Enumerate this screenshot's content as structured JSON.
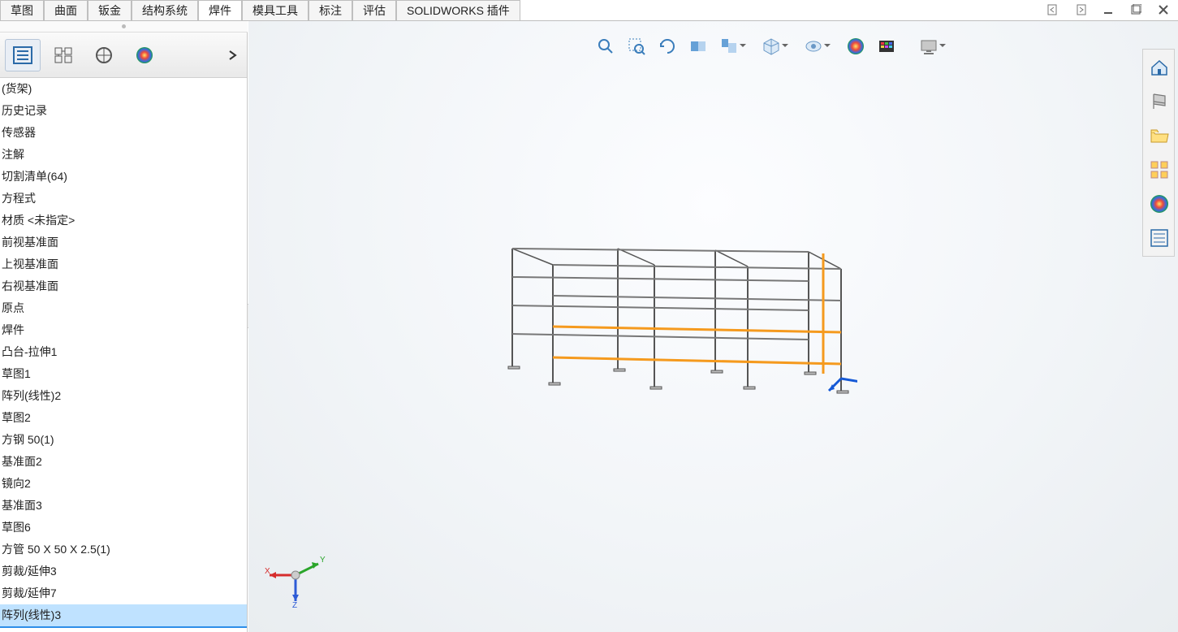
{
  "tabs": {
    "items": [
      "草图",
      "曲面",
      "钣金",
      "结构系统",
      "焊件",
      "模具工具",
      "标注",
      "评估",
      "SOLIDWORKS 插件"
    ],
    "activeIndex": 4
  },
  "windowControls": {
    "collapseLeft": "‹",
    "collapseRight": "›",
    "minimize": "—",
    "maximize": "❐",
    "close": "✕"
  },
  "panelToolbar": {
    "tab1": "feature-manager-icon",
    "tab2": "property-manager-icon",
    "tab3": "configuration-manager-icon",
    "tab4": "appearance-manager-icon"
  },
  "featureTree": {
    "items": [
      {
        "label": "(货架)"
      },
      {
        "label": "历史记录"
      },
      {
        "label": "传感器"
      },
      {
        "label": "注解"
      },
      {
        "label": "切割清单(64)"
      },
      {
        "label": "方程式"
      },
      {
        "label": "材质 <未指定>"
      },
      {
        "label": "前视基准面"
      },
      {
        "label": "上视基准面"
      },
      {
        "label": "右视基准面"
      },
      {
        "label": "原点"
      },
      {
        "label": "焊件"
      },
      {
        "label": "凸台-拉伸1"
      },
      {
        "label": "草图1"
      },
      {
        "label": "阵列(线性)2"
      },
      {
        "label": "草图2"
      },
      {
        "label": "方钢 50(1)"
      },
      {
        "label": "基准面2"
      },
      {
        "label": "镜向2"
      },
      {
        "label": "基准面3"
      },
      {
        "label": "草图6"
      },
      {
        "label": "方管 50 X 50 X 2.5(1)"
      },
      {
        "label": "剪裁/延伸3"
      },
      {
        "label": "剪裁/延伸7"
      },
      {
        "label": "阵列(线性)3"
      }
    ],
    "selectedIndex": 24
  },
  "hud": {
    "tools": [
      {
        "name": "zoom-fit-icon",
        "dd": false
      },
      {
        "name": "zoom-area-icon",
        "dd": false
      },
      {
        "name": "previous-view-icon",
        "dd": false
      },
      {
        "name": "section-view-icon",
        "dd": false
      },
      {
        "name": "dynamic-zoom-icon",
        "dd": true
      },
      {
        "name": "sep"
      },
      {
        "name": "view-orientation-icon",
        "dd": true
      },
      {
        "name": "sep"
      },
      {
        "name": "display-style-icon",
        "dd": true
      },
      {
        "name": "sep"
      },
      {
        "name": "scene-icon",
        "dd": false
      },
      {
        "name": "render-icon",
        "dd": false
      },
      {
        "name": "sep"
      },
      {
        "name": "monitor-icon",
        "dd": true
      }
    ]
  },
  "taskPane": {
    "items": [
      {
        "name": "home-icon"
      },
      {
        "name": "resources-icon"
      },
      {
        "name": "open-icon"
      },
      {
        "name": "view-palette-icon"
      },
      {
        "name": "appearances-icon"
      },
      {
        "name": "custom-props-icon"
      }
    ]
  },
  "triad": {
    "x": "X",
    "y": "Y",
    "z": "Z"
  },
  "colors": {
    "accent": "#2e8ee8",
    "selection": "#bfe2ff",
    "modelOrange": "#f59a1e",
    "modelGray": "#8d8d8d"
  }
}
